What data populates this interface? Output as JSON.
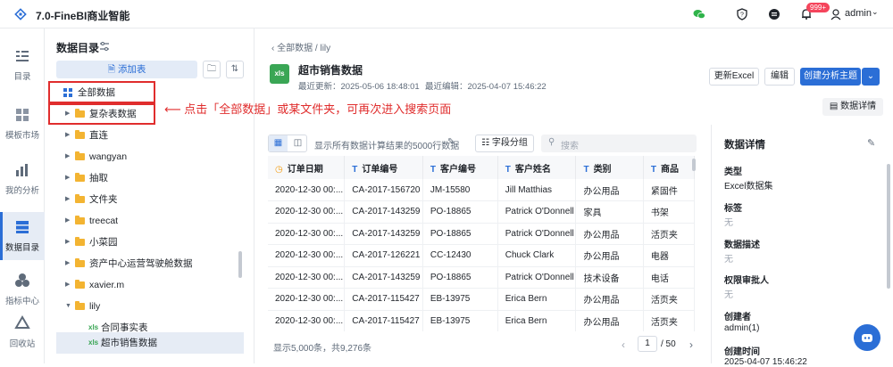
{
  "app": {
    "title": "7.0-FineBI商业智能",
    "badge": "999+",
    "user": "admin"
  },
  "nav": [
    {
      "label": "目录"
    },
    {
      "label": "模板市场"
    },
    {
      "label": "我的分析"
    },
    {
      "label": "数据目录"
    },
    {
      "label": "指标中心"
    },
    {
      "label": "回收站"
    }
  ],
  "tree": {
    "title": "数据目录",
    "add_label": "添加表",
    "items": [
      {
        "label": "全部数据"
      },
      {
        "label": "复杂表数据"
      },
      {
        "label": "直连"
      },
      {
        "label": "wangyan"
      },
      {
        "label": "抽取"
      },
      {
        "label": "文件夹"
      },
      {
        "label": "treecat"
      },
      {
        "label": "小菜园"
      },
      {
        "label": "资产中心运营驾驶舱数据"
      },
      {
        "label": "xavier.m"
      },
      {
        "label": "lily"
      },
      {
        "label": "合同事实表",
        "type": "xls"
      },
      {
        "label": "超市销售数据",
        "type": "xls"
      }
    ]
  },
  "annotation": "点击「全部数据」或某文件夹，可再次进入搜索页面",
  "breadcrumb": {
    "root": "全部数据",
    "sep": "/",
    "current": "lily"
  },
  "dataset": {
    "icon_text": "xls",
    "name": "超市销售数据",
    "updated": "最近更新：2025-05-06 18:48:01",
    "edited": "最近编辑：2025-04-07 15:46:22"
  },
  "toolbar": {
    "update_excel": "更新Excel",
    "edit": "编辑",
    "create_theme": "创建分析主题",
    "detail": "数据详情"
  },
  "preview": {
    "info": "显示所有数据计算结果的5000行数据",
    "field_group": "字段分组",
    "search_placeholder": "搜索"
  },
  "table": {
    "columns": [
      "订单日期",
      "订单编号",
      "客户编号",
      "客户姓名",
      "类别",
      "商品"
    ],
    "rows": [
      [
        "2020-12-30 00:...",
        "CA-2017-156720",
        "JM-15580",
        "Jill Matthias",
        "办公用品",
        "紧固件"
      ],
      [
        "2020-12-30 00:...",
        "CA-2017-143259",
        "PO-18865",
        "Patrick O'Donnell",
        "家具",
        "书架"
      ],
      [
        "2020-12-30 00:...",
        "CA-2017-143259",
        "PO-18865",
        "Patrick O'Donnell",
        "办公用品",
        "活页夹"
      ],
      [
        "2020-12-30 00:...",
        "CA-2017-126221",
        "CC-12430",
        "Chuck Clark",
        "办公用品",
        "电器"
      ],
      [
        "2020-12-30 00:...",
        "CA-2017-143259",
        "PO-18865",
        "Patrick O'Donnell",
        "技术设备",
        "电话"
      ],
      [
        "2020-12-30 00:...",
        "CA-2017-115427",
        "EB-13975",
        "Erica Bern",
        "办公用品",
        "活页夹"
      ],
      [
        "2020-12-30 00:...",
        "CA-2017-115427",
        "EB-13975",
        "Erica Bern",
        "办公用品",
        "活页夹"
      ]
    ]
  },
  "footer": {
    "shown": "显示5,000条，共9,276条",
    "page": "1",
    "total_pages": "/ 50"
  },
  "details": {
    "title": "数据详情",
    "type_key": "类型",
    "type_val": "Excel数据集",
    "tag_key": "标签",
    "tag_val": "无",
    "desc_key": "数据描述",
    "desc_val": "无",
    "approver_key": "权限审批人",
    "approver_val": "无",
    "creator_key": "创建者",
    "creator_val": "admin(1)",
    "created_key": "创建时间",
    "created_val": "2025-04-07 15:46:22"
  },
  "colors": {
    "accent": "#2b6ed6",
    "annotation": "#e02d2d",
    "folder": "#f3b432"
  }
}
